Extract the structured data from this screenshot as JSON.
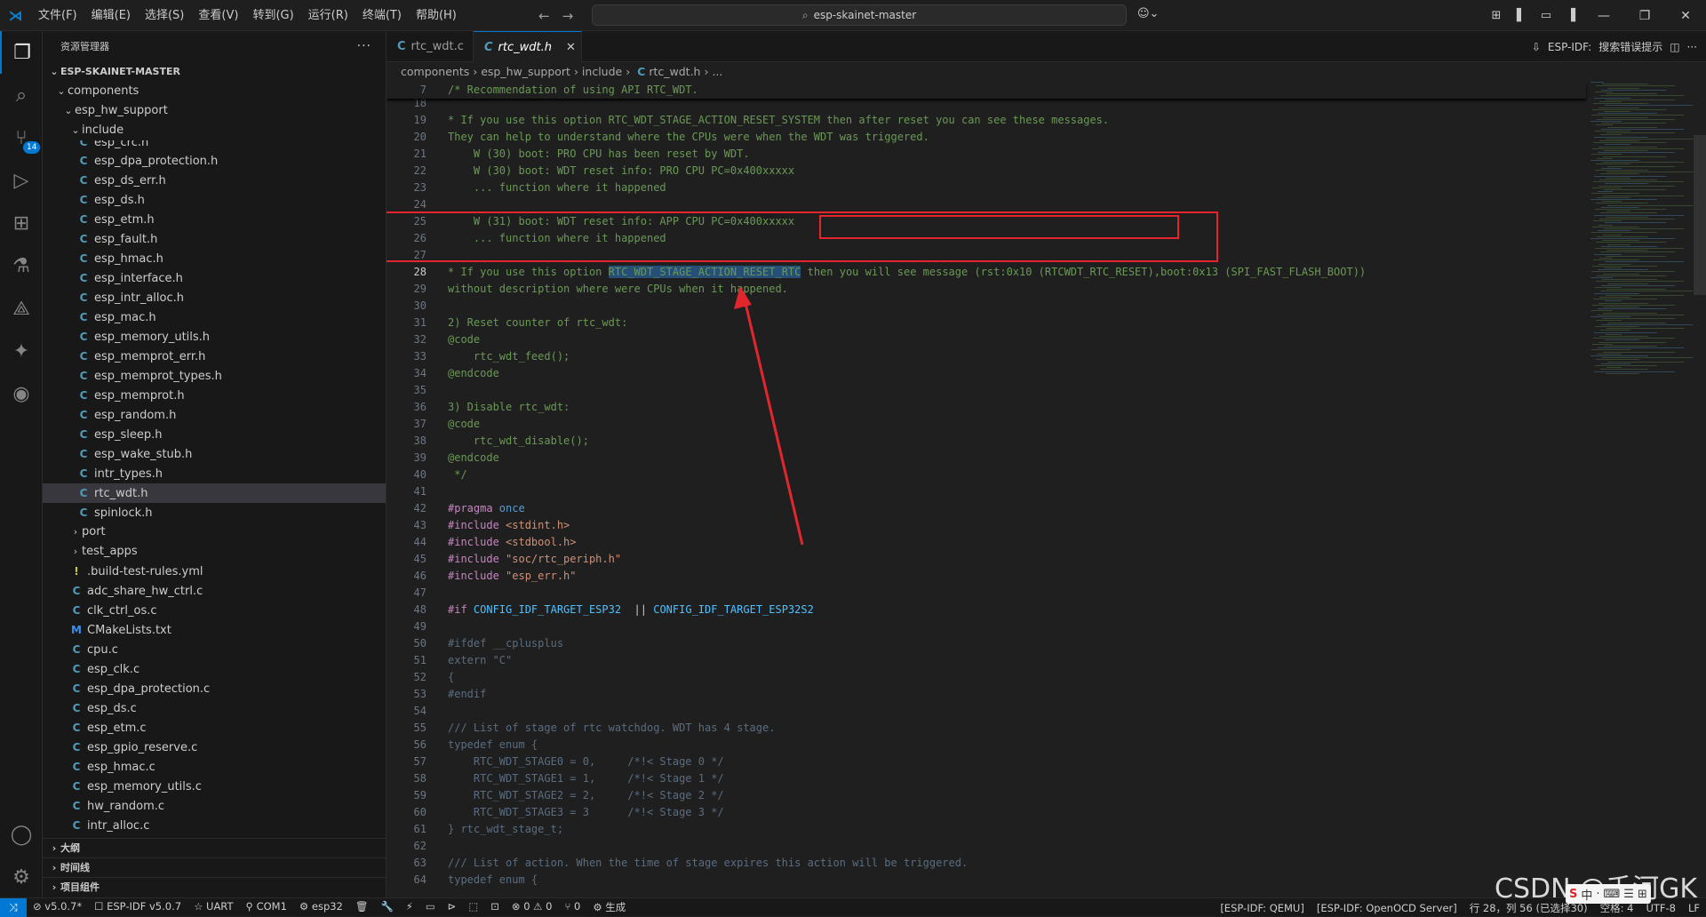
{
  "titlebar": {
    "menus": [
      "文件(F)",
      "编辑(E)",
      "选择(S)",
      "查看(V)",
      "转到(G)",
      "运行(R)",
      "终端(T)",
      "帮助(H)"
    ],
    "search": "esp-skainet-master"
  },
  "activitybar": {
    "icons": [
      "explorer-icon",
      "search-icon",
      "source-control-icon",
      "run-debug-icon",
      "extensions-icon",
      "testing-icon",
      "remote-icon",
      "espidf-icon",
      "esp-icon"
    ],
    "scm_badge": "14"
  },
  "sidebar": {
    "title": "资源管理器",
    "more": "···",
    "root": "ESP-SKAINET-MASTER",
    "tree": [
      {
        "label": "components",
        "depth": 1,
        "type": "folder-open"
      },
      {
        "label": "esp_hw_support",
        "depth": 2,
        "type": "folder-open"
      },
      {
        "label": "include",
        "depth": 3,
        "type": "folder-open"
      },
      {
        "label": "esp_crc.h",
        "depth": 4,
        "type": "c",
        "partial": true
      },
      {
        "label": "esp_dpa_protection.h",
        "depth": 4,
        "type": "c"
      },
      {
        "label": "esp_ds_err.h",
        "depth": 4,
        "type": "c"
      },
      {
        "label": "esp_ds.h",
        "depth": 4,
        "type": "c"
      },
      {
        "label": "esp_etm.h",
        "depth": 4,
        "type": "c"
      },
      {
        "label": "esp_fault.h",
        "depth": 4,
        "type": "c"
      },
      {
        "label": "esp_hmac.h",
        "depth": 4,
        "type": "c"
      },
      {
        "label": "esp_interface.h",
        "depth": 4,
        "type": "c"
      },
      {
        "label": "esp_intr_alloc.h",
        "depth": 4,
        "type": "c"
      },
      {
        "label": "esp_mac.h",
        "depth": 4,
        "type": "c"
      },
      {
        "label": "esp_memory_utils.h",
        "depth": 4,
        "type": "c"
      },
      {
        "label": "esp_memprot_err.h",
        "depth": 4,
        "type": "c"
      },
      {
        "label": "esp_memprot_types.h",
        "depth": 4,
        "type": "c"
      },
      {
        "label": "esp_memprot.h",
        "depth": 4,
        "type": "c"
      },
      {
        "label": "esp_random.h",
        "depth": 4,
        "type": "c"
      },
      {
        "label": "esp_sleep.h",
        "depth": 4,
        "type": "c"
      },
      {
        "label": "esp_wake_stub.h",
        "depth": 4,
        "type": "c"
      },
      {
        "label": "intr_types.h",
        "depth": 4,
        "type": "c"
      },
      {
        "label": "rtc_wdt.h",
        "depth": 4,
        "type": "c",
        "selected": true
      },
      {
        "label": "spinlock.h",
        "depth": 4,
        "type": "c"
      },
      {
        "label": "port",
        "depth": 3,
        "type": "folder"
      },
      {
        "label": "test_apps",
        "depth": 3,
        "type": "folder"
      },
      {
        "label": ".build-test-rules.yml",
        "depth": 3,
        "type": "yml"
      },
      {
        "label": "adc_share_hw_ctrl.c",
        "depth": 3,
        "type": "c"
      },
      {
        "label": "clk_ctrl_os.c",
        "depth": 3,
        "type": "c"
      },
      {
        "label": "CMakeLists.txt",
        "depth": 3,
        "type": "m"
      },
      {
        "label": "cpu.c",
        "depth": 3,
        "type": "c"
      },
      {
        "label": "esp_clk.c",
        "depth": 3,
        "type": "c"
      },
      {
        "label": "esp_dpa_protection.c",
        "depth": 3,
        "type": "c"
      },
      {
        "label": "esp_ds.c",
        "depth": 3,
        "type": "c"
      },
      {
        "label": "esp_etm.c",
        "depth": 3,
        "type": "c"
      },
      {
        "label": "esp_gpio_reserve.c",
        "depth": 3,
        "type": "c"
      },
      {
        "label": "esp_hmac.c",
        "depth": 3,
        "type": "c"
      },
      {
        "label": "esp_memory_utils.c",
        "depth": 3,
        "type": "c"
      },
      {
        "label": "hw_random.c",
        "depth": 3,
        "type": "c"
      },
      {
        "label": "intr_alloc.c",
        "depth": 3,
        "type": "c"
      }
    ],
    "panels": [
      "大纲",
      "时间线",
      "项目组件"
    ]
  },
  "tabs": [
    {
      "label": "rtc_wdt.c",
      "active": false
    },
    {
      "label": "rtc_wdt.h",
      "active": true,
      "close": "✕"
    }
  ],
  "editor_actions": {
    "label": "ESP-IDF:",
    "action": "搜索错误提示"
  },
  "breadcrumb": {
    "parts": [
      "components",
      "esp_hw_support",
      "include",
      "rtc_wdt.h",
      "..."
    ]
  },
  "editor": {
    "sticky": {
      "line": "7",
      "text": "/* Recommendation of using API RTC_WDT."
    },
    "lines": [
      {
        "n": "18",
        "c": []
      },
      {
        "n": "19",
        "c": [
          [
            "cm",
            "* If you use this option RTC_WDT_STAGE_ACTION_RESET_SYSTEM then after reset you can see these messages."
          ]
        ]
      },
      {
        "n": "20",
        "c": [
          [
            "cm",
            "They can help to understand where the CPUs were when the WDT was triggered."
          ]
        ]
      },
      {
        "n": "21",
        "c": [
          [
            "cm",
            "    W (30) boot: PRO CPU has been reset by WDT."
          ]
        ]
      },
      {
        "n": "22",
        "c": [
          [
            "cm",
            "    W (30) boot: WDT reset info: PRO CPU PC=0x400xxxxx"
          ]
        ]
      },
      {
        "n": "23",
        "c": [
          [
            "cm",
            "    ... function where it happened"
          ]
        ]
      },
      {
        "n": "24",
        "c": []
      },
      {
        "n": "25",
        "c": [
          [
            "cm",
            "    W (31) boot: WDT reset info: APP CPU PC=0x400xxxxx"
          ]
        ]
      },
      {
        "n": "26",
        "c": [
          [
            "cm",
            "    ... function where it happened"
          ]
        ]
      },
      {
        "n": "27",
        "c": []
      },
      {
        "n": "28",
        "c": [
          [
            "cm",
            "* If you use this option "
          ],
          [
            "cm hl",
            "RTC_WDT_STAGE_ACTION_RESET_RTC"
          ],
          [
            "cm",
            " then you will see message (rst:0x10 (RTCWDT_RTC_RESET),boot:0x13 (SPI_FAST_FLASH_BOOT))"
          ]
        ],
        "cur": true
      },
      {
        "n": "29",
        "c": [
          [
            "cm",
            "without description where were CPUs when it happened."
          ]
        ]
      },
      {
        "n": "30",
        "c": []
      },
      {
        "n": "31",
        "c": [
          [
            "cm",
            "2) Reset counter of rtc_wdt:"
          ]
        ]
      },
      {
        "n": "32",
        "c": [
          [
            "cm",
            "@code"
          ]
        ]
      },
      {
        "n": "33",
        "c": [
          [
            "cm",
            "    rtc_wdt_feed();"
          ]
        ]
      },
      {
        "n": "34",
        "c": [
          [
            "cm",
            "@endcode"
          ]
        ]
      },
      {
        "n": "35",
        "c": []
      },
      {
        "n": "36",
        "c": [
          [
            "cm",
            "3) Disable rtc_wdt:"
          ]
        ]
      },
      {
        "n": "37",
        "c": [
          [
            "cm",
            "@code"
          ]
        ]
      },
      {
        "n": "38",
        "c": [
          [
            "cm",
            "    rtc_wdt_disable();"
          ]
        ]
      },
      {
        "n": "39",
        "c": [
          [
            "cm",
            "@endcode"
          ]
        ]
      },
      {
        "n": "40",
        "c": [
          [
            "cm",
            " */"
          ]
        ]
      },
      {
        "n": "41",
        "c": []
      },
      {
        "n": "42",
        "c": [
          [
            "pp",
            "#pragma"
          ],
          [
            "kw",
            " once"
          ]
        ]
      },
      {
        "n": "43",
        "c": [
          [
            "pp",
            "#include"
          ],
          [
            "st",
            " <stdint.h>"
          ]
        ]
      },
      {
        "n": "44",
        "c": [
          [
            "pp",
            "#include"
          ],
          [
            "st",
            " <stdbool.h>"
          ]
        ]
      },
      {
        "n": "45",
        "c": [
          [
            "pp",
            "#include"
          ],
          [
            "st",
            " \"soc/rtc_periph.h\""
          ]
        ]
      },
      {
        "n": "46",
        "c": [
          [
            "pp",
            "#include"
          ],
          [
            "st",
            " \"esp_err.h\""
          ]
        ]
      },
      {
        "n": "47",
        "c": []
      },
      {
        "n": "48",
        "c": [
          [
            "pp",
            "#if"
          ],
          [
            "mac",
            " CONFIG_IDF_TARGET_ESP32"
          ],
          [
            "",
            "",
            " "
          ],
          [
            "",
            " || "
          ],
          [
            "mac",
            "CONFIG_IDF_TARGET_ESP32S2"
          ]
        ]
      },
      {
        "n": "49",
        "c": []
      },
      {
        "n": "50",
        "c": [
          [
            "dim",
            "#ifdef __cplusplus"
          ]
        ]
      },
      {
        "n": "51",
        "c": [
          [
            "dim",
            "extern \"C\""
          ]
        ]
      },
      {
        "n": "52",
        "c": [
          [
            "dim",
            "{"
          ]
        ]
      },
      {
        "n": "53",
        "c": [
          [
            "dim",
            "#endif"
          ]
        ]
      },
      {
        "n": "54",
        "c": []
      },
      {
        "n": "55",
        "c": [
          [
            "dim",
            "/// List of stage of rtc watchdog. WDT has 4 stage."
          ]
        ]
      },
      {
        "n": "56",
        "c": [
          [
            "dim",
            "typedef enum {"
          ]
        ]
      },
      {
        "n": "57",
        "c": [
          [
            "dim",
            "    RTC_WDT_STAGE0 = 0,     /*!< Stage 0 */"
          ]
        ]
      },
      {
        "n": "58",
        "c": [
          [
            "dim",
            "    RTC_WDT_STAGE1 = 1,     /*!< Stage 1 */"
          ]
        ]
      },
      {
        "n": "59",
        "c": [
          [
            "dim",
            "    RTC_WDT_STAGE2 = 2,     /*!< Stage 2 */"
          ]
        ]
      },
      {
        "n": "60",
        "c": [
          [
            "dim",
            "    RTC_WDT_STAGE3 = 3      /*!< Stage 3 */"
          ]
        ]
      },
      {
        "n": "61",
        "c": [
          [
            "dim",
            "} rtc_wdt_stage_t;"
          ]
        ]
      },
      {
        "n": "62",
        "c": []
      },
      {
        "n": "63",
        "c": [
          [
            "dim",
            "/// List of action. When the time of stage expires this action will be triggered."
          ]
        ]
      },
      {
        "n": "64",
        "c": [
          [
            "dim",
            "typedef enum {"
          ]
        ]
      }
    ]
  },
  "statusbar": {
    "left": [
      "⊘ v5.0.7*",
      "☐ ESP-IDF v5.0.7",
      "☆ UART",
      "⚲ COM1",
      "⚙ esp32",
      "🗑",
      "🔧",
      "⚡",
      "▭",
      "⊳",
      "⬚",
      "⊡",
      "⊗ 0 ⚠ 0",
      "⑂ 0",
      "⚙ 生成"
    ],
    "right": [
      "[ESP-IDF: QEMU]",
      "[ESP-IDF: OpenOCD Server]",
      "行 28，列 56 (已选择30)",
      "空格: 4",
      "UTF-8",
      "LF"
    ]
  },
  "watermark": "CSDN @千河GK",
  "ime": [
    "S",
    "中",
    "·",
    "⌨",
    "☰",
    "⊞"
  ]
}
